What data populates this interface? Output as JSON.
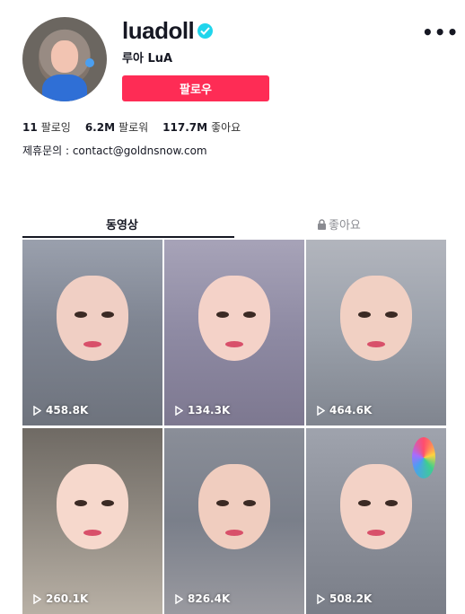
{
  "profile": {
    "username": "luadoll",
    "nickname": "루아 LuA",
    "follow_label": "팔로우",
    "more_label": "•••",
    "bio": "제휴문의 : contact@goldnsnow.com"
  },
  "stats": {
    "following_value": "11",
    "following_label": "팔로잉",
    "followers_value": "6.2M",
    "followers_label": "팔로워",
    "likes_value": "117.7M",
    "likes_label": "좋아요"
  },
  "tabs": {
    "videos": "동영상",
    "liked": "좋아요"
  },
  "colors": {
    "accent": "#fe2c55",
    "verified": "#20d5ec"
  },
  "videos": [
    {
      "views": "458.8K"
    },
    {
      "views": "134.3K"
    },
    {
      "views": "464.6K"
    },
    {
      "views": "260.1K"
    },
    {
      "views": "826.4K"
    },
    {
      "views": "508.2K"
    }
  ]
}
